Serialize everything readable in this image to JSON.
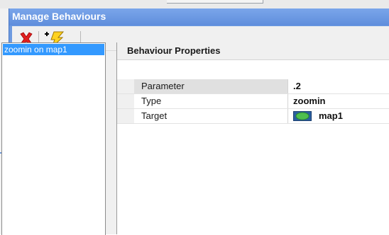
{
  "window": {
    "title": "Manage Behaviours"
  },
  "toolbar": {
    "delete_icon": "red-x-icon",
    "add_icon": "add-lightning-icon"
  },
  "behaviours": [
    {
      "label": "zoomin on map1",
      "selected": true
    }
  ],
  "properties": {
    "title": "Behaviour Properties",
    "rows": [
      {
        "name": "Parameter",
        "value": ".2"
      },
      {
        "name": "Type",
        "value": "zoomin"
      },
      {
        "name": "Target",
        "value": "map1",
        "icon": "map-icon"
      }
    ]
  },
  "colors": {
    "titlebar": "#6d9ae0",
    "selection": "#3399ff"
  }
}
